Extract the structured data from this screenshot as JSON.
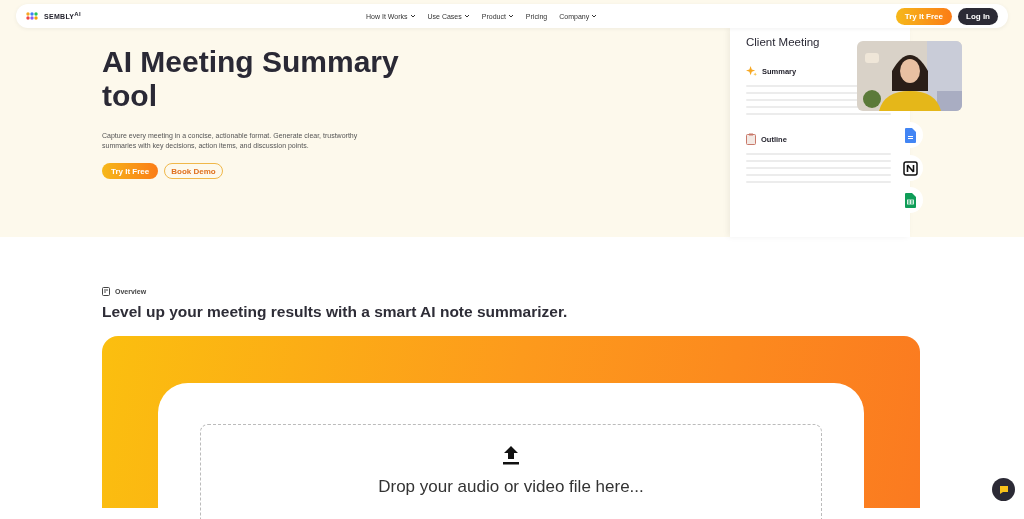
{
  "nav": {
    "logo": "SEMBLY",
    "logo_sup": "AI",
    "links": [
      {
        "label": "How It Works",
        "dropdown": true
      },
      {
        "label": "Use Cases",
        "dropdown": true
      },
      {
        "label": "Product",
        "dropdown": true
      },
      {
        "label": "Pricing",
        "dropdown": false
      },
      {
        "label": "Company",
        "dropdown": true
      }
    ],
    "try_button": "Try It Free",
    "login_button": "Log In"
  },
  "hero": {
    "title": "AI Meeting Summary tool",
    "description": "Capture every meeting in a concise, actionable format. Generate clear, trustworthy summaries with key decisions, action items, and discussion points.",
    "primary_button": "Try It Free",
    "secondary_button": "Book Demo"
  },
  "preview": {
    "title": "Client Meeting",
    "sections": [
      {
        "label": "Summary",
        "kind": "summary"
      },
      {
        "label": "Outline",
        "kind": "outline"
      }
    ]
  },
  "overview": {
    "tag": "Overview",
    "heading": "Level up your meeting results with a smart AI note summarizer.",
    "drop_text": "Drop your audio or video file here..."
  }
}
